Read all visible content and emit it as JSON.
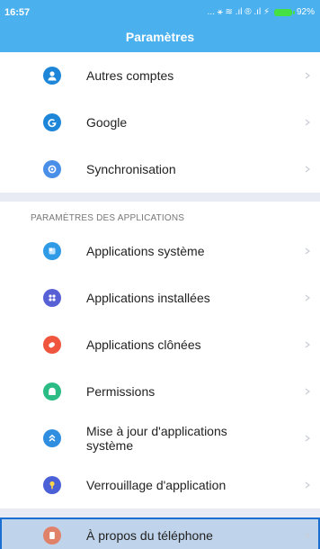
{
  "status": {
    "time": "16:57",
    "icons_text": "... ⚹ ≋ .ıl ® .ıl ⚡",
    "battery_pct": "92%",
    "battery_color": "#44e044"
  },
  "header": {
    "title": "Paramètres"
  },
  "colors": {
    "accent": "#4ab0ee",
    "selection_bg": "#bfd3ea",
    "selection_border": "#1a6fd1"
  },
  "accounts": [
    {
      "label": "Autres comptes",
      "icon": "user-icon",
      "color": "#1e86d8"
    },
    {
      "label": "Google",
      "icon": "google-icon",
      "color": "#1e86d8"
    },
    {
      "label": "Synchronisation",
      "icon": "sync-icon",
      "color": "#4a8fe7"
    }
  ],
  "apps_section": {
    "title": "PARAMÈTRES DES APPLICATIONS",
    "items": [
      {
        "label": "Applications système",
        "icon": "system-apps-icon",
        "color": "#2f9ae6"
      },
      {
        "label": "Applications installées",
        "icon": "installed-apps-icon",
        "color": "#5860d6"
      },
      {
        "label": "Applications clônées",
        "icon": "cloned-apps-icon",
        "color": "#f0553d"
      },
      {
        "label": "Permissions",
        "icon": "permissions-icon",
        "color": "#2bbc86"
      },
      {
        "label": "Mise à jour d'applications système",
        "icon": "update-icon",
        "color": "#2f8ee0"
      },
      {
        "label": "Verrouillage d'application",
        "icon": "lock-icon",
        "color": "#4b5fd6"
      }
    ]
  },
  "about": {
    "label": "À propos du téléphone",
    "icon": "phone-info-icon",
    "color": "#e0826a"
  }
}
